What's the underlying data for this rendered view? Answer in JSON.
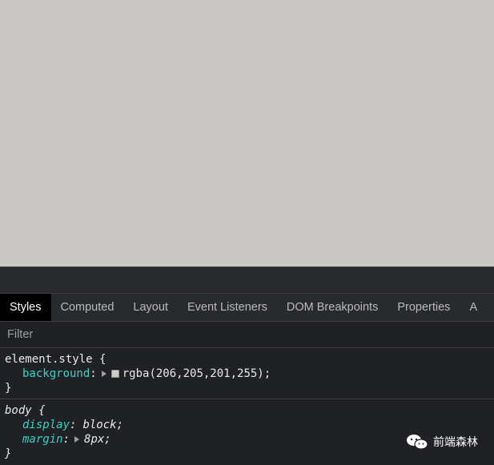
{
  "viewport": {
    "background": "#c9c8c4"
  },
  "devtools": {
    "tabs": [
      {
        "label": "Styles",
        "active": true
      },
      {
        "label": "Computed"
      },
      {
        "label": "Layout"
      },
      {
        "label": "Event Listeners"
      },
      {
        "label": "DOM Breakpoints"
      },
      {
        "label": "Properties"
      },
      {
        "label": "A"
      }
    ],
    "filter": {
      "placeholder": "Filter"
    },
    "rules": {
      "element_style": {
        "selector": "element.style {",
        "decls": [
          {
            "prop": "background",
            "colon": ":",
            "value": "rgba(206,205,201,255);",
            "swatch": "#cecdc9"
          }
        ],
        "close": "}"
      },
      "body": {
        "selector": "body {",
        "decls": [
          {
            "prop": "display",
            "colon": ":",
            "value": "block;"
          },
          {
            "prop": "margin",
            "colon": ":",
            "value": "8px;"
          }
        ],
        "close": "}"
      }
    }
  },
  "watermark": {
    "text": "前端森林",
    "icon": "wechat-icon"
  }
}
